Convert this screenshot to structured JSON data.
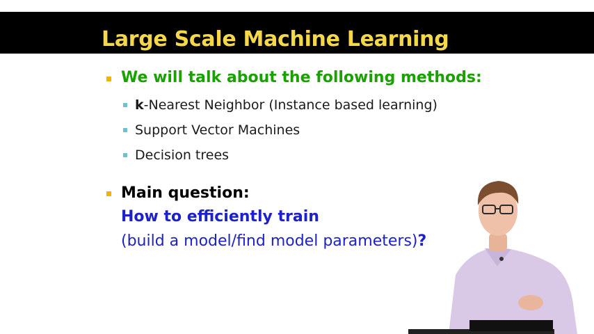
{
  "slide": {
    "title": "Large Scale Machine Learning",
    "intro": "We will talk about the following methods:",
    "methods": [
      {
        "bold_prefix": "k",
        "text": "-Nearest Neighbor (Instance based learning)"
      },
      {
        "bold_prefix": "",
        "text": "Support Vector Machines"
      },
      {
        "bold_prefix": "",
        "text": "Decision trees"
      }
    ],
    "question_heading": "Main question:",
    "question_line1": "How to efficiently train",
    "question_line2": "(build a model/find model parameters)",
    "question_mark": "?"
  },
  "colors": {
    "title_bar": "#000000",
    "title_text": "#f4d84a",
    "intro_green": "#1aa100",
    "question_blue": "#1c22c8",
    "primary_bullet": "#f0b400",
    "secondary_bullet": "#6fc0d0"
  },
  "presenter": {
    "icon": "presenter-video-overlay"
  }
}
